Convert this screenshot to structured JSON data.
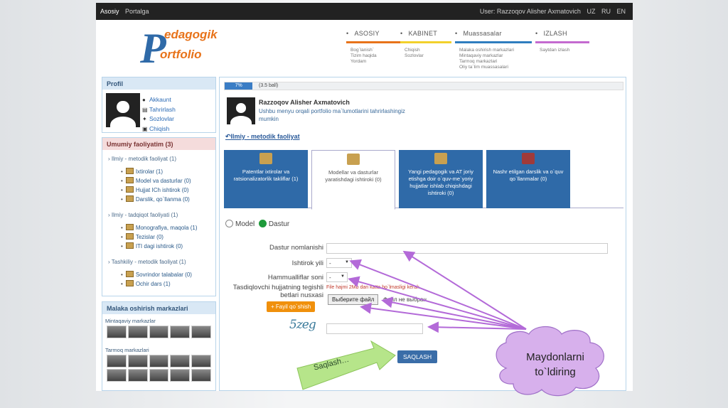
{
  "topbar": {
    "left": [
      "Asosiy",
      "Portalga"
    ],
    "user": "User: Razzoqov Alisher Axmatovich",
    "langs": [
      "UZ",
      "RU",
      "EN"
    ]
  },
  "logo": {
    "line1": "edagogik",
    "line2": "ortfolio"
  },
  "menu": [
    {
      "title": "ASOSIY",
      "color": "#e8731a",
      "sub": [
        "Bog`lanish`",
        "Tizim haqida",
        "Yordam"
      ]
    },
    {
      "title": "KABINET",
      "color": "#f2d12c",
      "sub": [
        "Chiqish",
        "Sozlovlar"
      ]
    },
    {
      "title": "Muassasalar",
      "color": "#2f7dbf",
      "sub": [
        "Malaka oshirish markazlari",
        "Mintaqaviy markazlar",
        "Tarmoq markazlari",
        "Oliy ta`lim muassasalari"
      ]
    },
    {
      "title": "IZLASH",
      "color": "#c46ad0",
      "sub": [
        "Saytdan izlash"
      ]
    }
  ],
  "profile": {
    "title": "Profil",
    "links": [
      {
        "icon": "user-icon",
        "label": "Akkaunt"
      },
      {
        "icon": "edit-icon",
        "label": "Tahrirlash"
      },
      {
        "icon": "wrench-icon",
        "label": "Sozlovlar"
      },
      {
        "icon": "lock-icon",
        "label": "Chiqish"
      }
    ]
  },
  "activities": {
    "title": "Umumiy faoliyatim (3)",
    "groups": [
      {
        "label": "› Ilmiy - metodik faoliyat (1)",
        "items": [
          "Ixtirolar (1)",
          "Model va dasturlar (0)",
          "Hujjat ICh ishtirok (0)",
          "Darslik, qo`llanma (0)"
        ]
      },
      {
        "label": "› Ilmiy - tadqiqot faoliyati (1)",
        "items": [
          "Monografiya, maqola (1)",
          "Tezislar (0)",
          "ITI dagi ishtirok (0)"
        ]
      },
      {
        "label": "› Tashkiliy - metodik faoliyat (1)",
        "items": [
          "Sovrindor talabalar (0)",
          "Ochir dars (1)"
        ]
      }
    ]
  },
  "centers": {
    "title": "Malaka oshirish markazlari",
    "regional": "Mintaqaviy markazlar",
    "network": "Tarmoq markazlari"
  },
  "progress": {
    "percent": 7,
    "label": "7%",
    "points": "(3.5 ball)"
  },
  "user": {
    "name": "Razzoqov Alisher Axmatovich",
    "desc": "Ushbu menyu orqali portfolio ma`lumotlarini tahrirlashingiz mumkin"
  },
  "section": "Ilmiy - metodik faoliyat",
  "tabs": [
    {
      "label": "Patentlar ixtirolar va ratsionalizatorlik takliflar (1)",
      "active": false
    },
    {
      "label": "Modellar va dasturlar yaratishdagi ishtiroki (0)",
      "active": true
    },
    {
      "label": "Yangi pedagogik va AT joriy etishga doir o`quv-me`yoriy hujjatlar ishlab chiqishdagi ishtiroki (0)",
      "active": false
    },
    {
      "label": "Nashr etilgan darslik va o`quv qo`llanmalar (0)",
      "active": false
    }
  ],
  "radio": {
    "model": "Model",
    "dastur": "Dastur",
    "selected": "dastur"
  },
  "form": {
    "name_label": "Dastur nomlanishi",
    "year_label": "Ishtirok yili",
    "year_value": "-",
    "coauthors_label": "Hammualliflar soni",
    "coauthors_value": "-",
    "doc_label": "Tasdiqlovchi hujjatning tegishli betlari nusxasi",
    "file_warning": "File hajmi 2Mb dan katta bo`lmasligi kerak",
    "file_button": "Выберите файл",
    "file_status": "Файл не выбран",
    "add_file": "+ Fayil qo`shish",
    "captcha": "5zeg",
    "save": "SAQLASH"
  },
  "annotations": {
    "arrow_label": "Saqlash…",
    "cloud_label": "Maydonlarni to`ldiring"
  }
}
